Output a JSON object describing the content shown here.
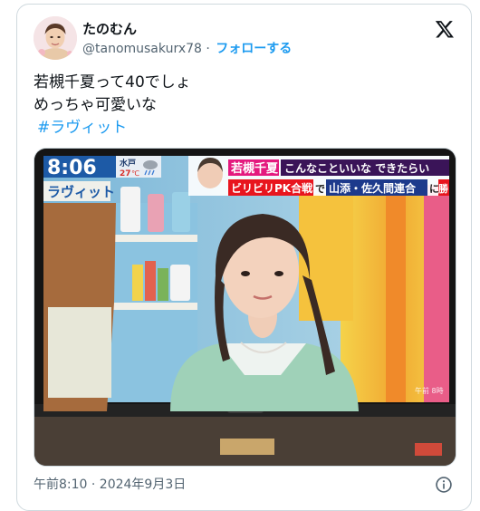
{
  "tweet": {
    "display_name": "たのむん",
    "handle": "@tanomusakurx78",
    "separator": "·",
    "follow_label": "フォローする",
    "text_lines": [
      "若槻千夏って40でしょ",
      "めっちゃ可愛いな"
    ],
    "hashtag": "#ラヴィット",
    "timestamp": "午前8:10 · 2024年9月3日"
  },
  "tv_screen": {
    "clock": "8:06",
    "location": "水戸",
    "temperature": "27",
    "temperature_unit": "℃",
    "show_logo": "ラヴィット",
    "caption_name": "若槻千夏",
    "caption_line1": "こんなこといいな できたらい",
    "caption_line2a": "ビリビリPK合戦",
    "caption_line2b": "で",
    "caption_line2c": "山添・佐久間連合",
    "caption_line2d": "に",
    "caption_line2e": "勝",
    "corner_text": "午前 8時"
  },
  "colors": {
    "accent": "#1d9bf0",
    "secondary_text": "#536471",
    "text": "#0f1419",
    "border": "#cfd9de"
  },
  "icons": {
    "brand": "x-logo-icon",
    "info": "info-icon",
    "weather": "weather-cloud-rain-icon"
  }
}
